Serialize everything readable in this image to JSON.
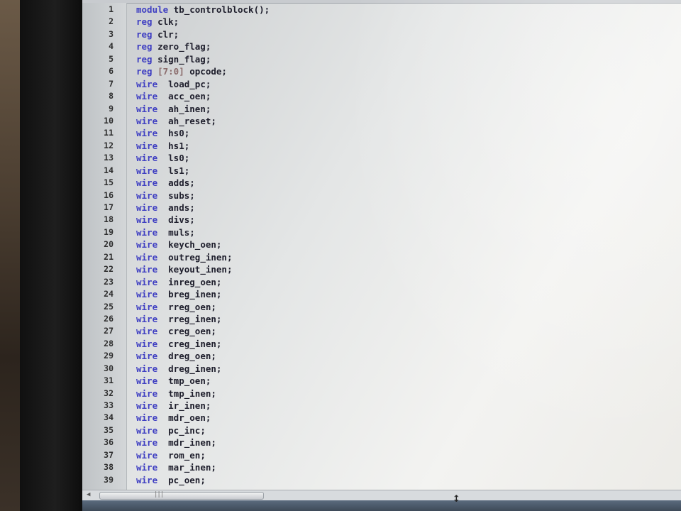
{
  "editor": {
    "lines": [
      {
        "n": "1",
        "kw": "module",
        "rest": " tb_controlblock();",
        "range": ""
      },
      {
        "n": "2",
        "kw": "reg",
        "rest": " clk;",
        "range": ""
      },
      {
        "n": "3",
        "kw": "reg",
        "rest": " clr;",
        "range": ""
      },
      {
        "n": "4",
        "kw": "reg",
        "rest": " zero_flag;",
        "range": ""
      },
      {
        "n": "5",
        "kw": "reg",
        "rest": " sign_flag;",
        "range": ""
      },
      {
        "n": "6",
        "kw": "reg",
        "range": " [7:0]",
        "rest": " opcode;"
      },
      {
        "n": "7",
        "kw": "wire",
        "rest": "  load_pc;",
        "range": ""
      },
      {
        "n": "8",
        "kw": "wire",
        "rest": "  acc_oen;",
        "range": ""
      },
      {
        "n": "9",
        "kw": "wire",
        "rest": "  ah_inen;",
        "range": ""
      },
      {
        "n": "10",
        "kw": "wire",
        "rest": "  ah_reset;",
        "range": ""
      },
      {
        "n": "11",
        "kw": "wire",
        "rest": "  hs0;",
        "range": ""
      },
      {
        "n": "12",
        "kw": "wire",
        "rest": "  hs1;",
        "range": ""
      },
      {
        "n": "13",
        "kw": "wire",
        "rest": "  ls0;",
        "range": ""
      },
      {
        "n": "14",
        "kw": "wire",
        "rest": "  ls1;",
        "range": ""
      },
      {
        "n": "15",
        "kw": "wire",
        "rest": "  adds;",
        "range": ""
      },
      {
        "n": "16",
        "kw": "wire",
        "rest": "  subs;",
        "range": ""
      },
      {
        "n": "17",
        "kw": "wire",
        "rest": "  ands;",
        "range": ""
      },
      {
        "n": "18",
        "kw": "wire",
        "rest": "  divs;",
        "range": ""
      },
      {
        "n": "19",
        "kw": "wire",
        "rest": "  muls;",
        "range": ""
      },
      {
        "n": "20",
        "kw": "wire",
        "rest": "  keych_oen;",
        "range": ""
      },
      {
        "n": "21",
        "kw": "wire",
        "rest": "  outreg_inen;",
        "range": ""
      },
      {
        "n": "22",
        "kw": "wire",
        "rest": "  keyout_inen;",
        "range": ""
      },
      {
        "n": "23",
        "kw": "wire",
        "rest": "  inreg_oen;",
        "range": ""
      },
      {
        "n": "24",
        "kw": "wire",
        "rest": "  breg_inen;",
        "range": ""
      },
      {
        "n": "25",
        "kw": "wire",
        "rest": "  rreg_oen;",
        "range": ""
      },
      {
        "n": "26",
        "kw": "wire",
        "rest": "  rreg_inen;",
        "range": ""
      },
      {
        "n": "27",
        "kw": "wire",
        "rest": "  creg_oen;",
        "range": ""
      },
      {
        "n": "28",
        "kw": "wire",
        "rest": "  creg_inen;",
        "range": ""
      },
      {
        "n": "29",
        "kw": "wire",
        "rest": "  dreg_oen;",
        "range": ""
      },
      {
        "n": "30",
        "kw": "wire",
        "rest": "  dreg_inen;",
        "range": ""
      },
      {
        "n": "31",
        "kw": "wire",
        "rest": "  tmp_oen;",
        "range": ""
      },
      {
        "n": "32",
        "kw": "wire",
        "rest": "  tmp_inen;",
        "range": ""
      },
      {
        "n": "33",
        "kw": "wire",
        "rest": "  ir_inen;",
        "range": ""
      },
      {
        "n": "34",
        "kw": "wire",
        "rest": "  mdr_oen;",
        "range": ""
      },
      {
        "n": "35",
        "kw": "wire",
        "rest": "  pc_inc;",
        "range": ""
      },
      {
        "n": "36",
        "kw": "wire",
        "rest": "  mdr_inen;",
        "range": ""
      },
      {
        "n": "37",
        "kw": "wire",
        "rest": "  rom_en;",
        "range": ""
      },
      {
        "n": "38",
        "kw": "wire",
        "rest": "  mar_inen;",
        "range": ""
      },
      {
        "n": "39",
        "kw": "wire",
        "rest": "  pc_oen;",
        "range": ""
      }
    ]
  },
  "colors": {
    "keyword": "#3f3fc2",
    "identifier": "#1e1e2c",
    "line_number": "#2d2d2d"
  },
  "icons": {
    "scroll_left": "left-arrow-icon",
    "scroll_grip": "grip-icon",
    "splitter": "resize-handle-icon"
  }
}
